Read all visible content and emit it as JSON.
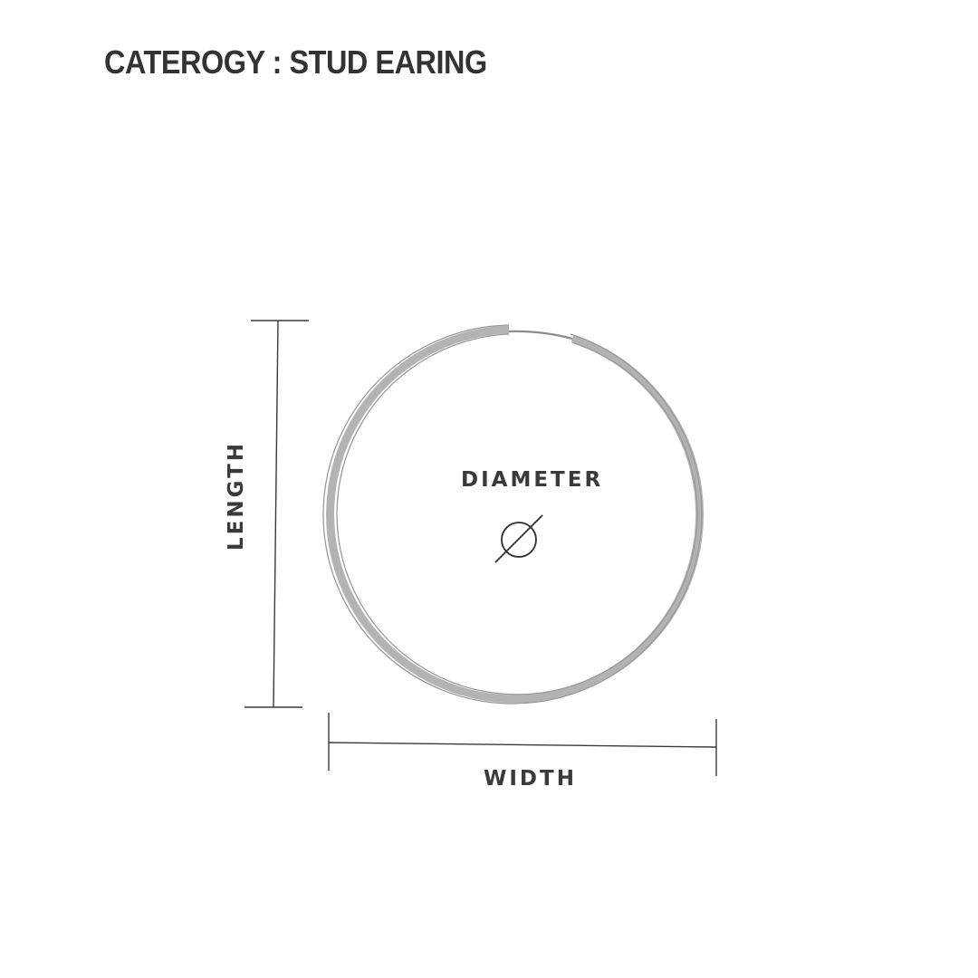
{
  "title": "CATEROGY : STUD EARING",
  "labels": {
    "diameter": "DIAMETER",
    "length": "LENGTH",
    "width": "WIDTH"
  },
  "icons": {
    "diameter_symbol": "diameter-icon"
  },
  "colors": {
    "text": "#333333",
    "hoop": "#a9a9a9",
    "dimension_line": "#333333",
    "background": "#ffffff"
  }
}
